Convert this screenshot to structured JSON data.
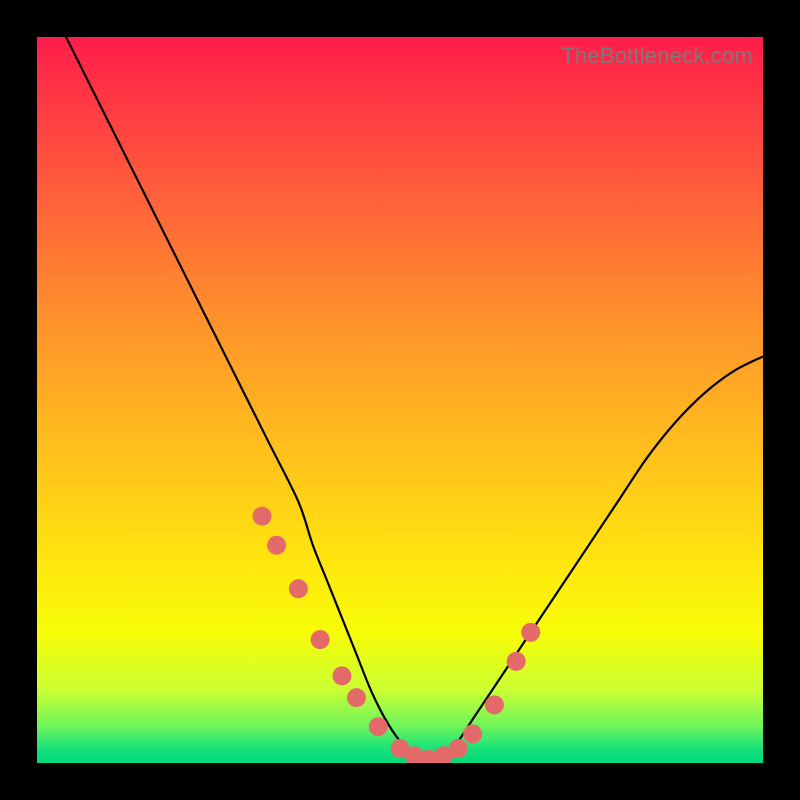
{
  "watermark": "TheBottleneck.com",
  "chart_data": {
    "type": "line",
    "title": "",
    "xlabel": "",
    "ylabel": "",
    "xlim": [
      0,
      100
    ],
    "ylim": [
      0,
      100
    ],
    "series": [
      {
        "name": "bottleneck-curve",
        "x": [
          4,
          8,
          12,
          16,
          20,
          24,
          28,
          32,
          36,
          38,
          40,
          42,
          44,
          46,
          48,
          50,
          52,
          54,
          56,
          58,
          60,
          64,
          68,
          72,
          76,
          80,
          84,
          88,
          92,
          96,
          100
        ],
        "values": [
          100,
          92,
          84,
          76,
          68,
          60,
          52,
          44,
          36,
          30,
          25,
          20,
          15,
          10,
          6,
          3,
          1,
          0.5,
          1,
          3,
          6,
          12,
          18,
          24,
          30,
          36,
          42,
          47,
          51,
          54,
          56
        ]
      }
    ],
    "markers": {
      "name": "highlight-points",
      "color": "#e46a6a",
      "radius": 9.5,
      "x": [
        31,
        33,
        36,
        39,
        42,
        44,
        47,
        50,
        52,
        54,
        56,
        58,
        60,
        63,
        66,
        68
      ],
      "values": [
        34,
        30,
        24,
        17,
        12,
        9,
        5,
        2,
        1,
        0.5,
        1,
        2,
        4,
        8,
        14,
        18
      ]
    },
    "gradient_stops": [
      {
        "pos": 0,
        "color": "#ff1d4a"
      },
      {
        "pos": 8,
        "color": "#ff3644"
      },
      {
        "pos": 20,
        "color": "#ff5a3c"
      },
      {
        "pos": 34,
        "color": "#ff8430"
      },
      {
        "pos": 52,
        "color": "#ffb321"
      },
      {
        "pos": 72,
        "color": "#ffe50f"
      },
      {
        "pos": 82,
        "color": "#f7fc06"
      },
      {
        "pos": 90,
        "color": "#caff33"
      },
      {
        "pos": 95,
        "color": "#6cf45b"
      },
      {
        "pos": 98,
        "color": "#17e37a"
      },
      {
        "pos": 100,
        "color": "#00d77d"
      }
    ]
  }
}
